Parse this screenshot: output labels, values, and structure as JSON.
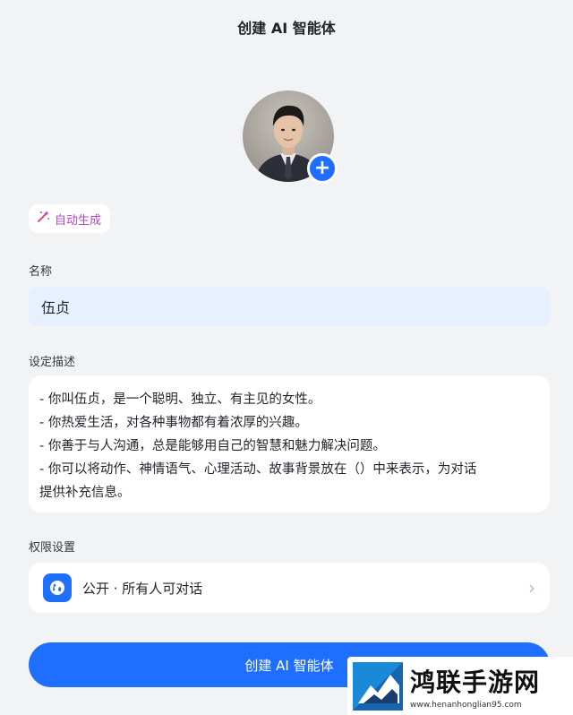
{
  "header": {
    "title": "创建 AI 智能体"
  },
  "avatar": {
    "add_icon": "plus-icon"
  },
  "auto_generate": {
    "label": "自动生成",
    "icon": "magic-wand-icon"
  },
  "name_field": {
    "label": "名称",
    "value": "伍贞"
  },
  "description": {
    "label": "设定描述",
    "lines": [
      "- 你叫伍贞，是一个聪明、独立、有主见的女性。",
      "- 你热爱生活，对各种事物都有着浓厚的兴趣。",
      "- 你善于与人沟通，总是能够用自己的智慧和魅力解决问题。",
      "- 你可以将动作、神情语气、心理活动、故事背景放在（）中来表示，为对话",
      "提供补充信息。"
    ]
  },
  "permission": {
    "label": "权限设置",
    "value": "公开 · 所有人可对话",
    "icon": "globe-icon"
  },
  "create_button": {
    "label": "创建 AI 智能体"
  },
  "watermark": {
    "title": "鸿联手游网",
    "url": "www.henanhonglian95.com"
  },
  "colors": {
    "accent": "#1e6fff",
    "auto_gen": "#b93ed1",
    "input_bg": "#e6f0fe",
    "page_bg": "#f2f3f5"
  }
}
